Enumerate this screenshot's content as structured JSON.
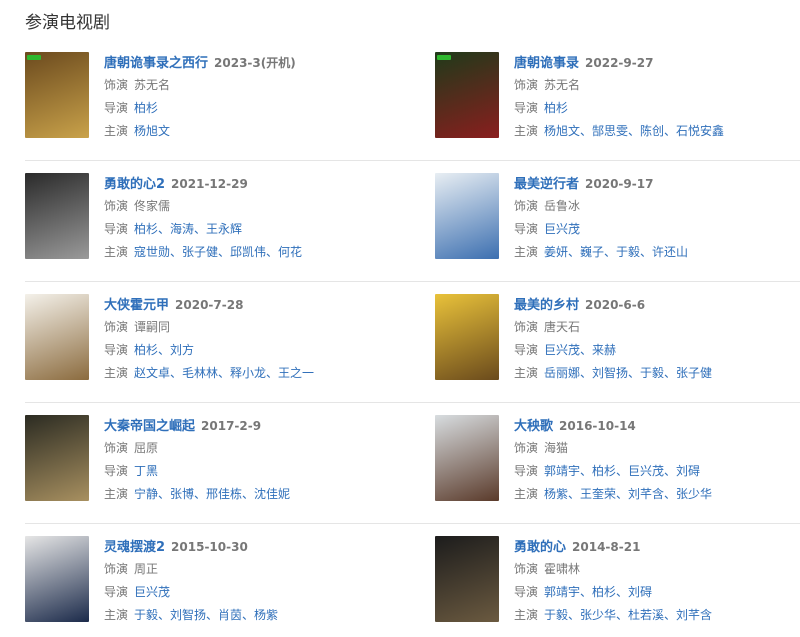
{
  "section_title": "参演电视剧",
  "labels": {
    "role": "饰演",
    "director": "导演",
    "cast": "主演"
  },
  "items": [
    {
      "title": "唐朝诡事录之西行",
      "date": "2023-3(开机)",
      "role": "苏无名",
      "director": "柏杉",
      "cast": "杨旭文",
      "poster_colors": [
        "#6b4a1e",
        "#c9a24a"
      ],
      "poster_badge": true
    },
    {
      "title": "唐朝诡事录",
      "date": "2022-9-27",
      "role": "苏无名",
      "director": "柏杉",
      "cast": "杨旭文、郜思雯、陈创、石悦安鑫",
      "poster_colors": [
        "#1f3a1a",
        "#8a1e1e"
      ],
      "poster_badge": true
    },
    {
      "title": "勇敢的心2",
      "date": "2021-12-29",
      "role": "佟家儒",
      "director": "柏杉、海涛、王永辉",
      "cast": "寇世勋、张子健、邱凯伟、何花",
      "poster_colors": [
        "#2a2a2a",
        "#9a9a9a"
      ],
      "poster_badge": false
    },
    {
      "title": "最美逆行者",
      "date": "2020-9-17",
      "role": "岳鲁冰",
      "director": "巨兴茂",
      "cast": "姜妍、巍子、于毅、许还山",
      "poster_colors": [
        "#e8eef3",
        "#3c6fb0"
      ],
      "poster_badge": false
    },
    {
      "title": "大侠霍元甲",
      "date": "2020-7-28",
      "role": "谭嗣同",
      "director": "柏杉、刘方",
      "cast": "赵文卓、毛林林、释小龙、王之一",
      "poster_colors": [
        "#f4f1ea",
        "#8b6b3e"
      ],
      "poster_badge": false
    },
    {
      "title": "最美的乡村",
      "date": "2020-6-6",
      "role": "唐天石",
      "director": "巨兴茂、来赫",
      "cast": "岳丽娜、刘智扬、于毅、张子健",
      "poster_colors": [
        "#e9c23a",
        "#6a4a1c"
      ],
      "poster_badge": false
    },
    {
      "title": "大秦帝国之崛起",
      "date": "2017-2-9",
      "role": "屈原",
      "director": "丁黑",
      "cast": "宁静、张博、邢佳栋、沈佳妮",
      "poster_colors": [
        "#2b2b22",
        "#a89060"
      ],
      "poster_badge": false
    },
    {
      "title": "大秧歌",
      "date": "2016-10-14",
      "role": "海猫",
      "director": "郭靖宇、柏杉、巨兴茂、刘碍",
      "cast": "杨紫、王奎荣、刘芊含、张少华",
      "poster_colors": [
        "#d8dde0",
        "#5a3a2a"
      ],
      "poster_badge": false
    },
    {
      "title": "灵魂摆渡2",
      "date": "2015-10-30",
      "role": "周正",
      "director": "巨兴茂",
      "cast": "于毅、刘智扬、肖茵、杨紫",
      "poster_colors": [
        "#e6e6e6",
        "#1b2a4a"
      ],
      "poster_badge": false
    },
    {
      "title": "勇敢的心",
      "date": "2014-8-21",
      "role": "霍啸林",
      "director": "郭靖宇、柏杉、刘碍",
      "cast": "于毅、张少华、杜若溪、刘芊含",
      "poster_colors": [
        "#1c1c1c",
        "#6b5a40"
      ],
      "poster_badge": false
    }
  ]
}
